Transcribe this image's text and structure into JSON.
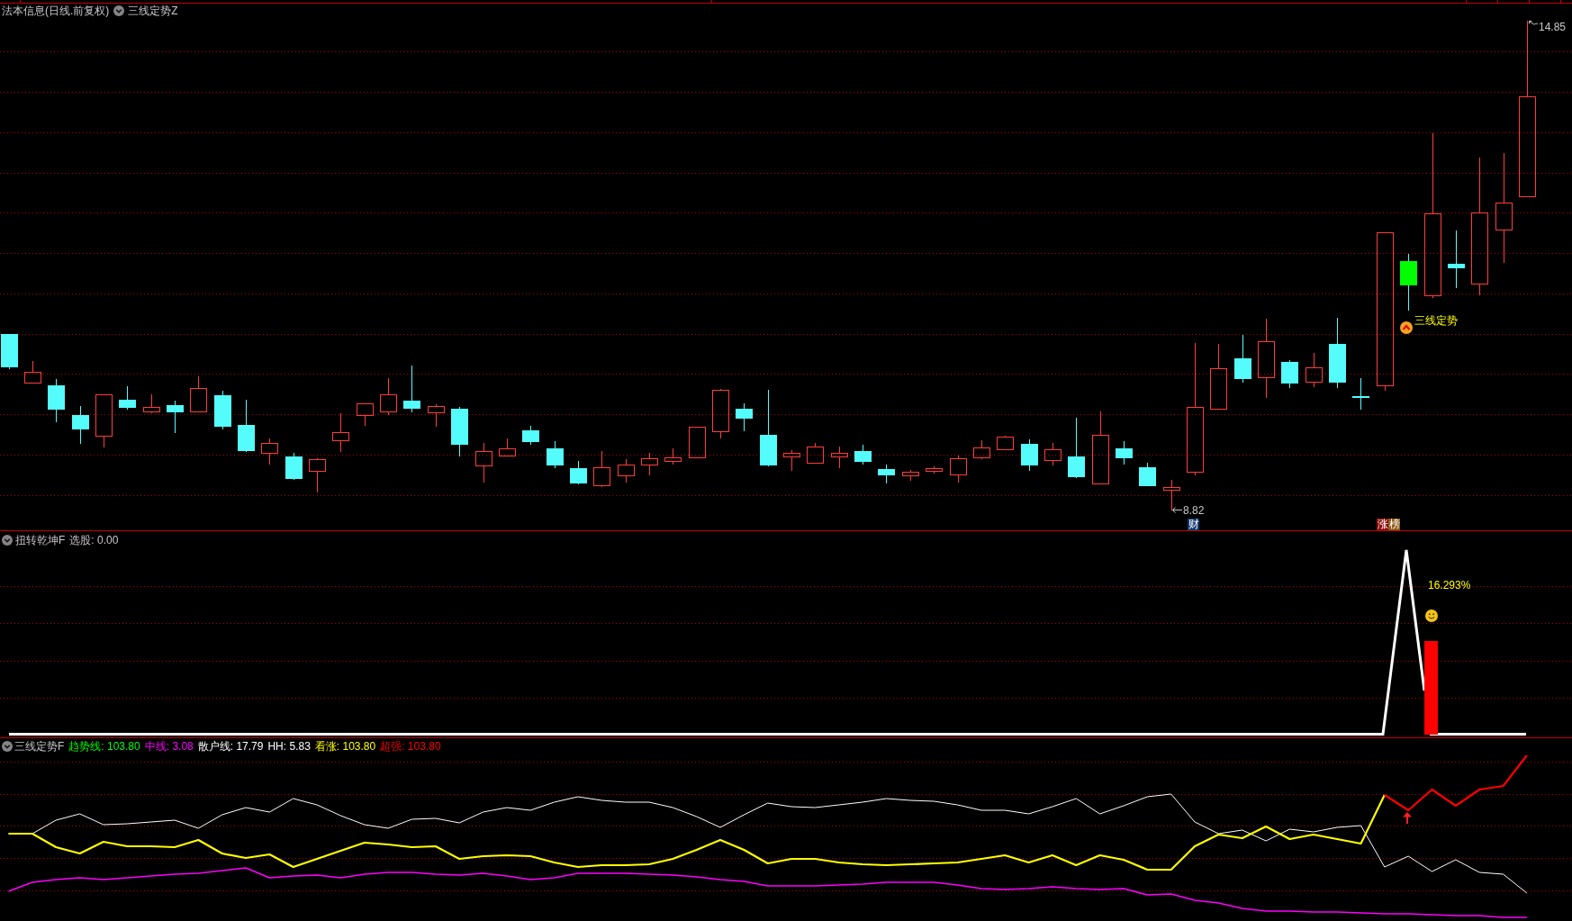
{
  "main_panel": {
    "title": "法本信息(日线.前复权)",
    "indicator": "三线定势Z",
    "high_label": "14.85",
    "low_label": "8.82",
    "signal_label": "三线定势",
    "markers": [
      {
        "text": "财",
        "color": "#123a70"
      },
      {
        "text": "涨",
        "color": "#8c0a0a"
      },
      {
        "text": "榜",
        "color": "#8c5a14"
      }
    ]
  },
  "signal_panel": {
    "title": "扭转乾坤F",
    "readout": "选股: 0.00",
    "percent_label": "16.293%"
  },
  "trend_panel": {
    "title": "三线定势F",
    "legend": [
      {
        "label": "趋势线: 103.80",
        "color": "#00ff00"
      },
      {
        "label": "中线: 3.08",
        "color": "#ff00ff"
      },
      {
        "label": "散户线: 17.79",
        "color": "#ffffff"
      },
      {
        "label": "HH: 5.83",
        "color": "#ffffff"
      },
      {
        "label": "看涨: 103.80",
        "color": "#ffff00"
      },
      {
        "label": "超强: 103.80",
        "color": "#ff0000"
      }
    ]
  }
}
